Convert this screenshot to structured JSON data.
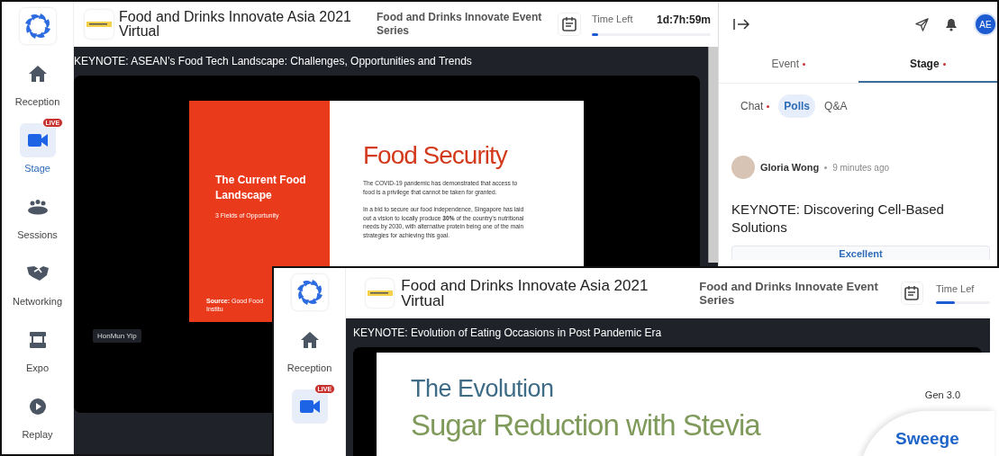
{
  "windows": [
    {
      "header": {
        "event_title": "Food and Drinks Innovate Asia 2021 Virtual",
        "series": "Food and Drinks Innovate Event Series",
        "time_left_label": "Time Left",
        "time_left": "1d:7h:59m",
        "progress": {
          "level": 0.05
        }
      },
      "sidebar": {
        "items": [
          {
            "label": "Reception",
            "selected": false
          },
          {
            "label": "Stage",
            "badge": "LIVE",
            "selected": true
          },
          {
            "label": "Sessions",
            "selected": false
          },
          {
            "label": "Networking",
            "selected": false
          },
          {
            "label": "Expo",
            "selected": false
          },
          {
            "label": "Replay",
            "selected": false
          }
        ]
      },
      "stage": {
        "session_title": "KEYNOTE: ASEAN’s Food Tech Landscape: Challenges, Opportunities and Trends",
        "speaker": "HonMun Yip",
        "slide": {
          "kind": "split",
          "left_title": "The Current Food Landscape",
          "left_subtitle": "3 Fields of Opportunity",
          "source": "**Source:** Good Food Institu",
          "heading": "Food Security",
          "paragraphs": [
            "The COVID-19 pandemic has demonstrated that access to food is a privilege that cannot be taken for granted.",
            "In a bid to secure our food independence, Singapore has laid out a vision to locally produce **30%** of the country’s nutritional needs by 2030, with alternative protein being one of the main strategies for achieving this goal."
          ]
        }
      },
      "panel": {
        "user_initials": "AE",
        "tabs": [
          {
            "label": "Event",
            "unread": true,
            "selected": false
          },
          {
            "label": "Stage",
            "unread": true,
            "selected": true
          }
        ],
        "subtabs": [
          {
            "label": "Chat",
            "unread": true,
            "selected": false
          },
          {
            "label": "Polls",
            "unread": false,
            "selected": true
          },
          {
            "label": "Q&A",
            "unread": false,
            "selected": false
          }
        ],
        "poll": {
          "author": "Gloria Wong",
          "time": "9 minutes ago",
          "question": "KEYNOTE: Discovering Cell-Based Solutions",
          "options": [
            "Excellent"
          ]
        }
      }
    },
    {
      "header": {
        "event_title": "Food and Drinks Innovate Asia 2021 Virtual",
        "series": "Food and Drinks Innovate Event Series",
        "time_left_label": "Time Lef",
        "progress": {
          "level": 0.35
        }
      },
      "sidebar": {
        "items": [
          {
            "label": "Reception",
            "selected": false
          },
          {
            "badge": "LIVE",
            "selected": true
          }
        ]
      },
      "stage": {
        "session_title": "KEYNOTE: Evolution of Eating Occasions in Post Pandemic Era",
        "slide": {
          "kind": "titled",
          "title": "The Evolution",
          "subtitle": "Sugar Reduction with Stevia",
          "tag": "Gen 3.0",
          "brand": "Sweege"
        }
      }
    }
  ]
}
